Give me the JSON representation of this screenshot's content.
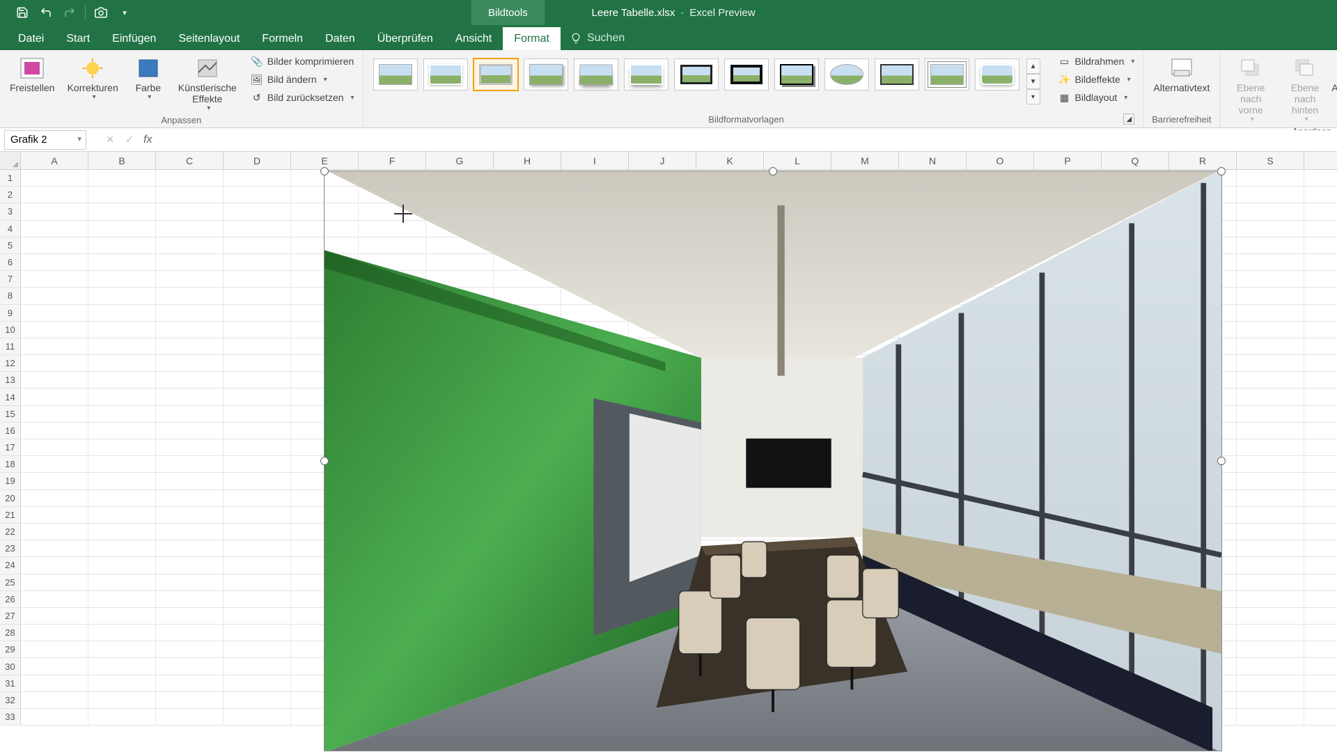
{
  "titlebar": {
    "contextual_label": "Bildtools",
    "doc_name": "Leere Tabelle.xlsx",
    "app_mode": "Excel Preview"
  },
  "tabs": {
    "file": "Datei",
    "home": "Start",
    "insert": "Einfügen",
    "pagelayout": "Seitenlayout",
    "formulas": "Formeln",
    "data": "Daten",
    "review": "Überprüfen",
    "view": "Ansicht",
    "format": "Format",
    "tellme": "Suchen"
  },
  "ribbon": {
    "remove_bg": "Freistellen",
    "corrections": "Korrekturen",
    "color": "Farbe",
    "artistic": "Künstlerische\nEffekte",
    "compress": "Bilder komprimieren",
    "change": "Bild ändern",
    "reset": "Bild zurücksetzen",
    "group_adjust": "Anpassen",
    "group_styles": "Bildformatvorlagen",
    "border": "Bildrahmen",
    "effects": "Bildeffekte",
    "layout": "Bildlayout",
    "alttext": "Alternativtext",
    "group_access": "Barrierefreiheit",
    "bring_fwd": "Ebene nach\nvorne",
    "send_back": "Ebene nach\nhinten",
    "selection_pane": "Auswahlbereich",
    "group_arrange": "Anordnen"
  },
  "fbar": {
    "namebox": "Grafik 2",
    "fx": "fx"
  },
  "cols": [
    "A",
    "B",
    "C",
    "D",
    "E",
    "F",
    "G",
    "H",
    "I",
    "J",
    "K",
    "L",
    "M",
    "N",
    "O",
    "P",
    "Q",
    "R",
    "S"
  ],
  "rows": [
    "1",
    "2",
    "3",
    "4",
    "5",
    "6",
    "7",
    "8",
    "9",
    "10",
    "11",
    "12",
    "13",
    "14",
    "15",
    "16",
    "17",
    "18",
    "19",
    "20",
    "21",
    "22",
    "23",
    "24",
    "25",
    "26",
    "27",
    "28",
    "29",
    "30",
    "31",
    "32",
    "33"
  ]
}
